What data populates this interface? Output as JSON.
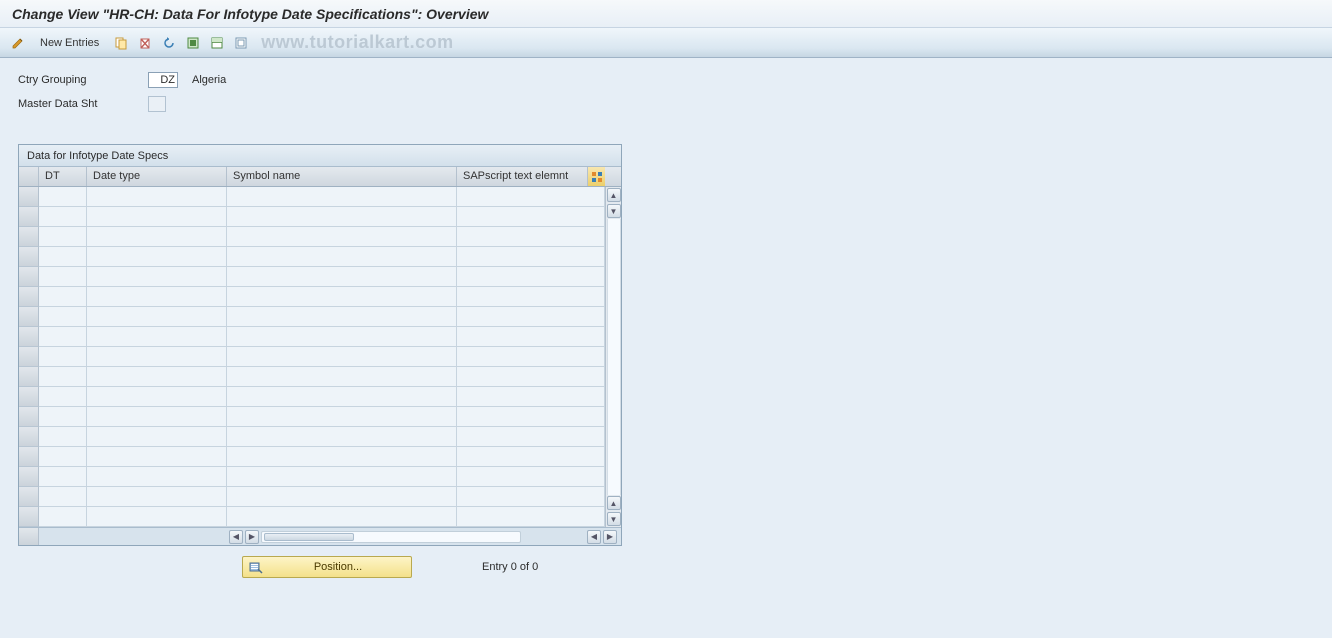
{
  "title": "Change View \"HR-CH: Data For Infotype Date Specifications\": Overview",
  "toolbar": {
    "new_entries_label": "New Entries"
  },
  "watermark": "www.tutorialkart.com",
  "form": {
    "ctry_grouping_label": "Ctry Grouping",
    "ctry_grouping_value": "DZ",
    "ctry_grouping_text": "Algeria",
    "master_data_label": "Master Data Sht"
  },
  "grid": {
    "title": "Data for Infotype Date Specs",
    "columns": {
      "dt": "DT",
      "date_type": "Date type",
      "symbol_name": "Symbol name",
      "sapscript": "SAPscript text elemnt"
    }
  },
  "footer": {
    "position_label": "Position...",
    "entry_text": "Entry 0 of 0"
  }
}
